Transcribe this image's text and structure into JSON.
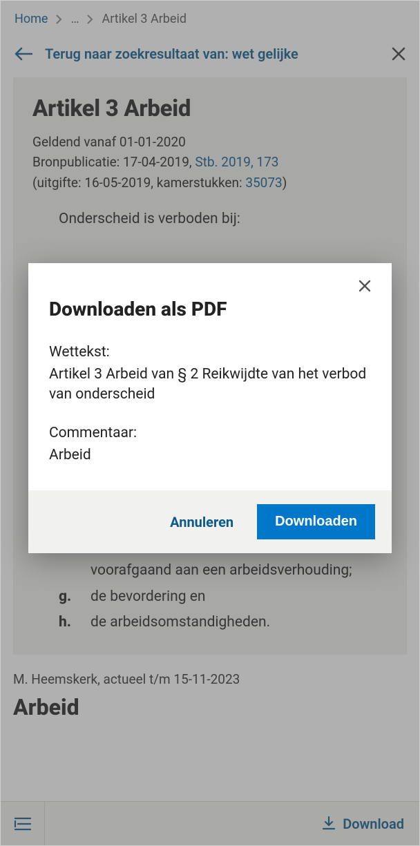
{
  "breadcrumb": {
    "home": "Home",
    "ellipsis": "…",
    "current": "Artikel 3 Arbeid"
  },
  "backbar": {
    "text": "Terug naar zoekresultaat van: wet gelijke"
  },
  "article": {
    "title": "Artikel 3 Arbeid",
    "valid_from_prefix": "Geldend vanaf ",
    "valid_from_date": "01-01-2020",
    "source_prefix": "Bronpublicatie: ",
    "source_date": "17-04-2019, ",
    "source_link": "Stb. 2019, 173",
    "issue_prefix": "(uitgifte: ",
    "issue_date": "16-05-2019, kamerstukken: ",
    "kamerstuk_link": "35073",
    "issue_suffix": ")",
    "list_intro": "Onderscheid is verboden bij:",
    "items_tail": [
      {
        "marker": "",
        "text": "voorafgaand aan een arbeidsverhouding;"
      },
      {
        "marker": "g.",
        "text": "de bevordering en"
      },
      {
        "marker": "h.",
        "text": "de arbeidsomstandigheden."
      }
    ]
  },
  "author_line": "M. Heemskerk, actueel t/m 15-11-2023",
  "section_heading": "Arbeid",
  "bottombar": {
    "download": "Download"
  },
  "modal": {
    "title": "Downloaden als PDF",
    "wettekst_label": "Wettekst:",
    "wettekst_value": "Artikel 3 Arbeid van § 2 Reikwijdte van het verbod van onderscheid",
    "commentaar_label": "Commentaar:",
    "commentaar_value": "Arbeid",
    "cancel": "Annuleren",
    "download": "Downloaden"
  }
}
